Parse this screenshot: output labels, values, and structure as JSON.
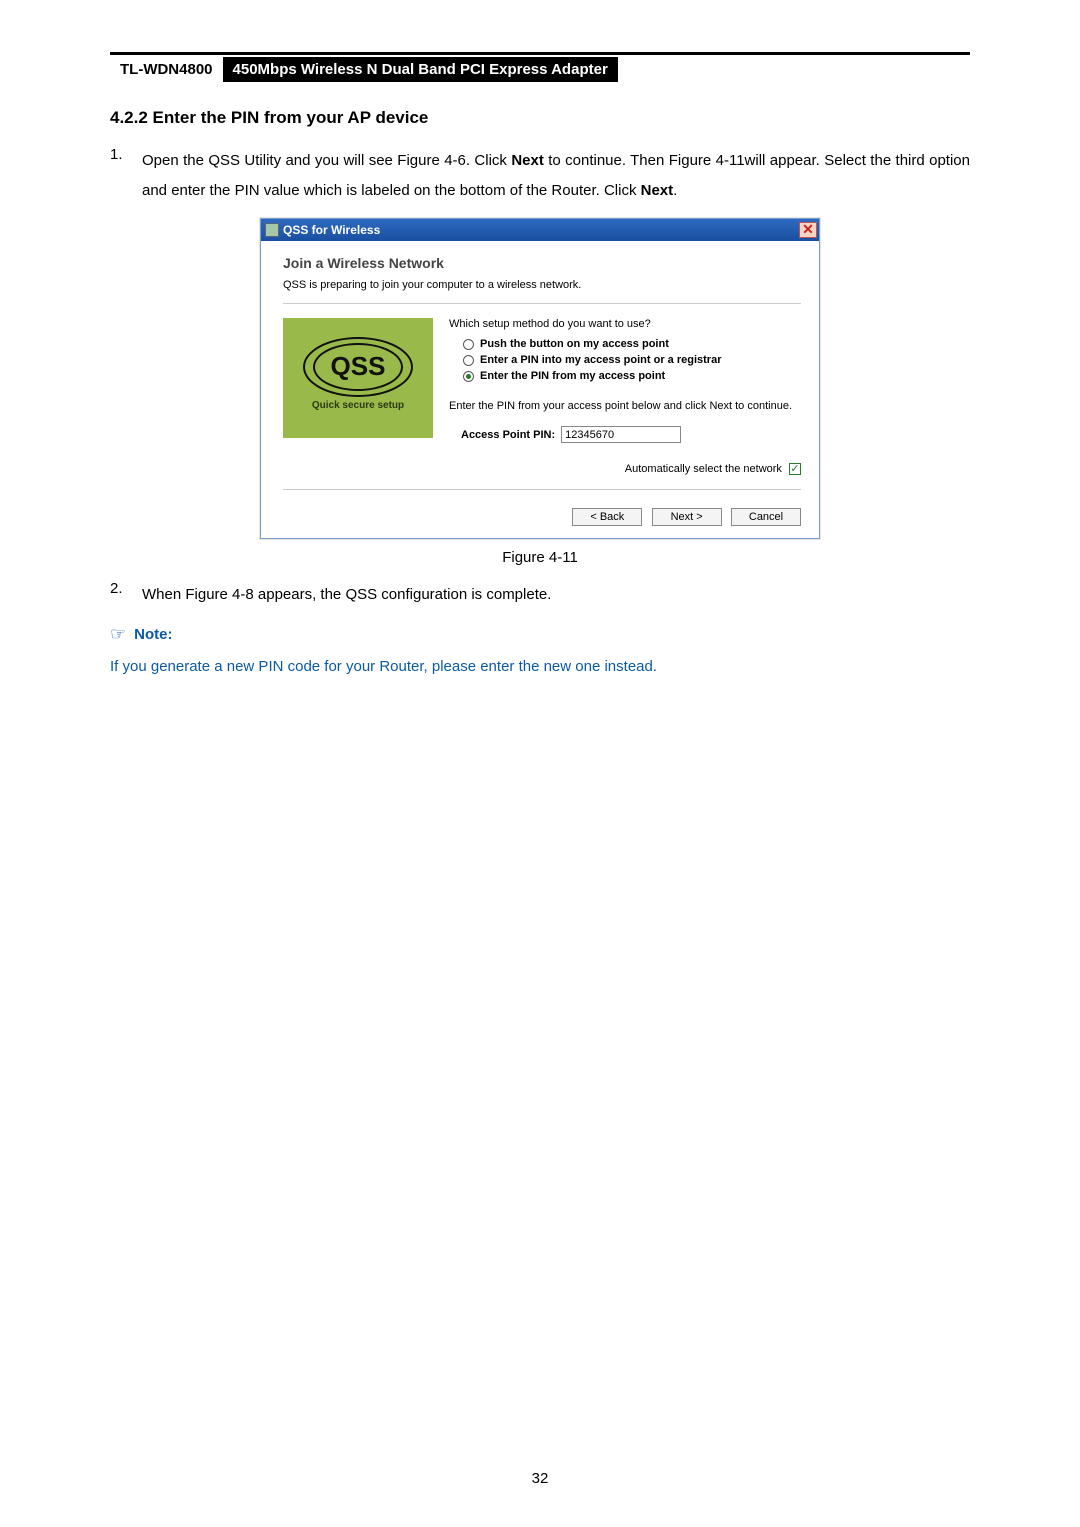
{
  "header": {
    "model": "TL-WDN4800",
    "desc": "450Mbps Wireless N Dual Band PCI Express Adapter"
  },
  "section_title": "4.2.2  Enter the PIN from your AP device",
  "step1_num": "1.",
  "step1_a": "Open the QSS Utility and you will see Figure 4-6. Click ",
  "step1_b": "Next",
  "step1_c": " to continue. Then Figure 4-11will appear. Select the third option and enter the PIN value which is labeled on the bottom of the Router. Click ",
  "step1_d": "Next",
  "step1_e": ".",
  "dialog": {
    "title": "QSS for Wireless",
    "heading": "Join a Wireless Network",
    "sub": "QSS is preparing to join your computer to a wireless network.",
    "logo_text": "QSS",
    "logo_cap": "Quick secure setup",
    "prompt": "Which setup method do you want to use?",
    "opt1": "Push the button on my access point",
    "opt2": "Enter a PIN into my access point or a registrar",
    "opt3": "Enter the PIN from my access point",
    "hint": "Enter the PIN from your access point below and click Next to continue.",
    "pin_label": "Access Point PIN:",
    "pin_value": "12345670",
    "auto_label": "Automatically select the network",
    "back": "< Back",
    "next": "Next >",
    "cancel": "Cancel"
  },
  "figure_caption": "Figure 4-11",
  "step2_num": "2.",
  "step2_body": "When Figure 4-8 appears, the QSS configuration is complete.",
  "note_label": "Note:",
  "note_body": "If you generate a new PIN code for your Router, please enter the new one instead.",
  "page_number": "32"
}
